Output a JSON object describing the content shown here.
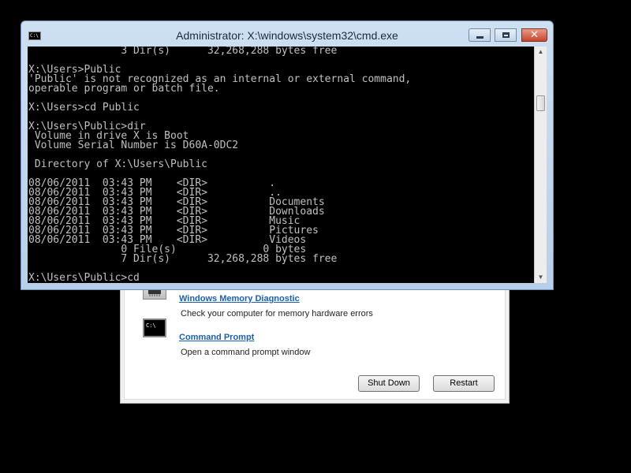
{
  "recovery": {
    "options": [
      {
        "title": "Windows Memory Diagnostic",
        "description": "Check your computer for memory hardware errors",
        "icon": "memory-chip-icon"
      },
      {
        "title": "Command Prompt",
        "description": "Open a command prompt window",
        "icon": "command-prompt-icon"
      }
    ],
    "shutdown_label": "Shut Down",
    "restart_label": "Restart"
  },
  "cmd": {
    "title": "Administrator: X:\\windows\\system32\\cmd.exe",
    "icon_text": "C:\\",
    "console_lines": [
      "               3 Dir(s)      32,268,288 bytes free",
      "",
      "X:\\Users>Public",
      "'Public' is not recognized as an internal or external command,",
      "operable program or batch file.",
      "",
      "X:\\Users>cd Public",
      "",
      "X:\\Users\\Public>dir",
      " Volume in drive X is Boot",
      " Volume Serial Number is D60A-0DC2",
      "",
      " Directory of X:\\Users\\Public",
      "",
      "08/06/2011  03:43 PM    <DIR>          .",
      "08/06/2011  03:43 PM    <DIR>          ..",
      "08/06/2011  03:43 PM    <DIR>          Documents",
      "08/06/2011  03:43 PM    <DIR>          Downloads",
      "08/06/2011  03:43 PM    <DIR>          Music",
      "08/06/2011  03:43 PM    <DIR>          Pictures",
      "08/06/2011  03:43 PM    <DIR>          Videos",
      "               0 File(s)              0 bytes",
      "               7 Dir(s)      32,268,288 bytes free",
      "",
      "X:\\Users\\Public>cd"
    ]
  }
}
